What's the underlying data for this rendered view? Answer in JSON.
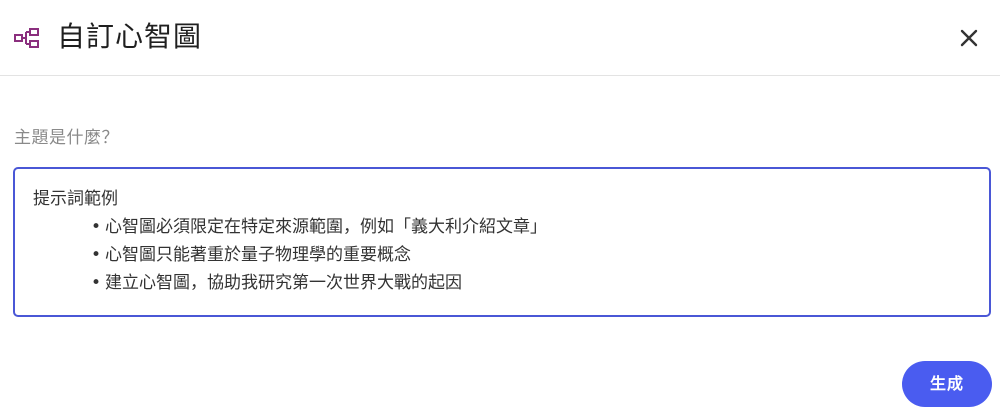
{
  "dialog": {
    "icon": "mind-map-icon",
    "title": "自訂心智圖",
    "close_icon": "close-icon"
  },
  "prompt": {
    "label": "主題是什麼？",
    "placeholder_heading": "提示詞範例",
    "examples": [
      "心智圖必須限定在特定來源範圍，例如「義大利介紹文章」",
      "心智圖只能著重於量子物理學的重要概念",
      "建立心智圖，協助我研究第一次世界大戰的起因"
    ]
  },
  "actions": {
    "generate_label": "生成"
  },
  "colors": {
    "accent": "#4a5cf0",
    "border_focus": "#4a57d6",
    "icon": "#8b2f7e"
  }
}
